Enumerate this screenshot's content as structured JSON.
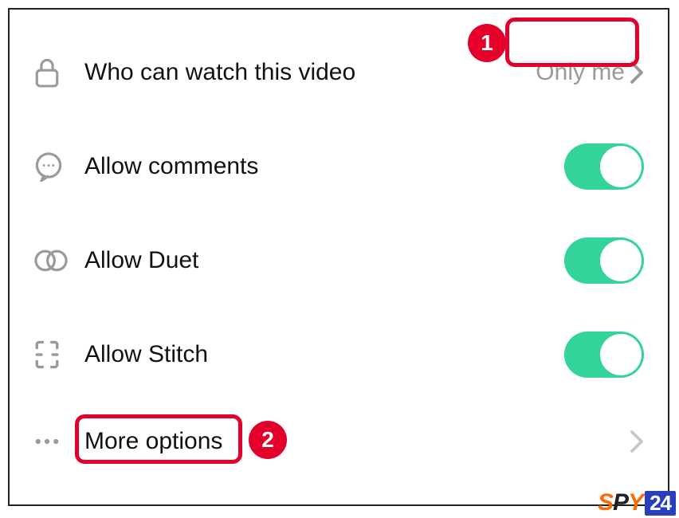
{
  "privacy": {
    "who_can_watch": {
      "label": "Who can watch this video",
      "value": "Only me"
    },
    "allow_comments": {
      "label": "Allow comments",
      "enabled": true
    },
    "allow_duet": {
      "label": "Allow Duet",
      "enabled": true
    },
    "allow_stitch": {
      "label": "Allow Stitch",
      "enabled": true
    },
    "more_options": {
      "label": "More options"
    }
  },
  "annotations": {
    "badge1": "1",
    "badge2": "2"
  },
  "watermark": {
    "s": "S",
    "p": "P",
    "y": "Y",
    "n": "24"
  }
}
